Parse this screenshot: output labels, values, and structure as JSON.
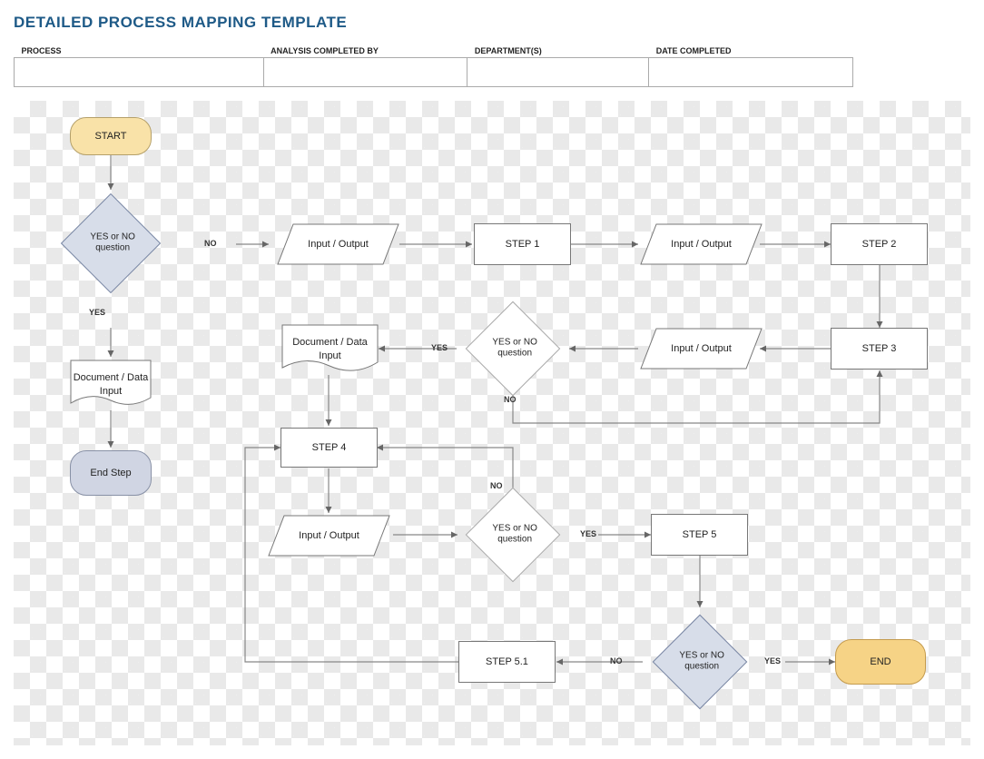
{
  "title": "DETAILED PROCESS MAPPING TEMPLATE",
  "header": {
    "process": "PROCESS",
    "analysis": "ANALYSIS COMPLETED BY",
    "department": "DEPARTMENT(S)",
    "date": "DATE COMPLETED"
  },
  "nodes": {
    "start": "START",
    "q1": "YES or NO question",
    "yes": "YES",
    "no": "NO",
    "doc1": "Document / Data Input",
    "endstep": "End Step",
    "io1": "Input / Output",
    "step1": "STEP 1",
    "io2": "Input / Output",
    "step2": "STEP 2",
    "step3": "STEP 3",
    "io3": "Input / Output",
    "q2": "YES or NO question",
    "doc2": "Document / Data Input",
    "step4": "STEP 4",
    "io4": "Input / Output",
    "q3": "YES or NO question",
    "step5": "STEP 5",
    "step51": "STEP 5.1",
    "q4": "YES or NO question",
    "end": "END"
  }
}
